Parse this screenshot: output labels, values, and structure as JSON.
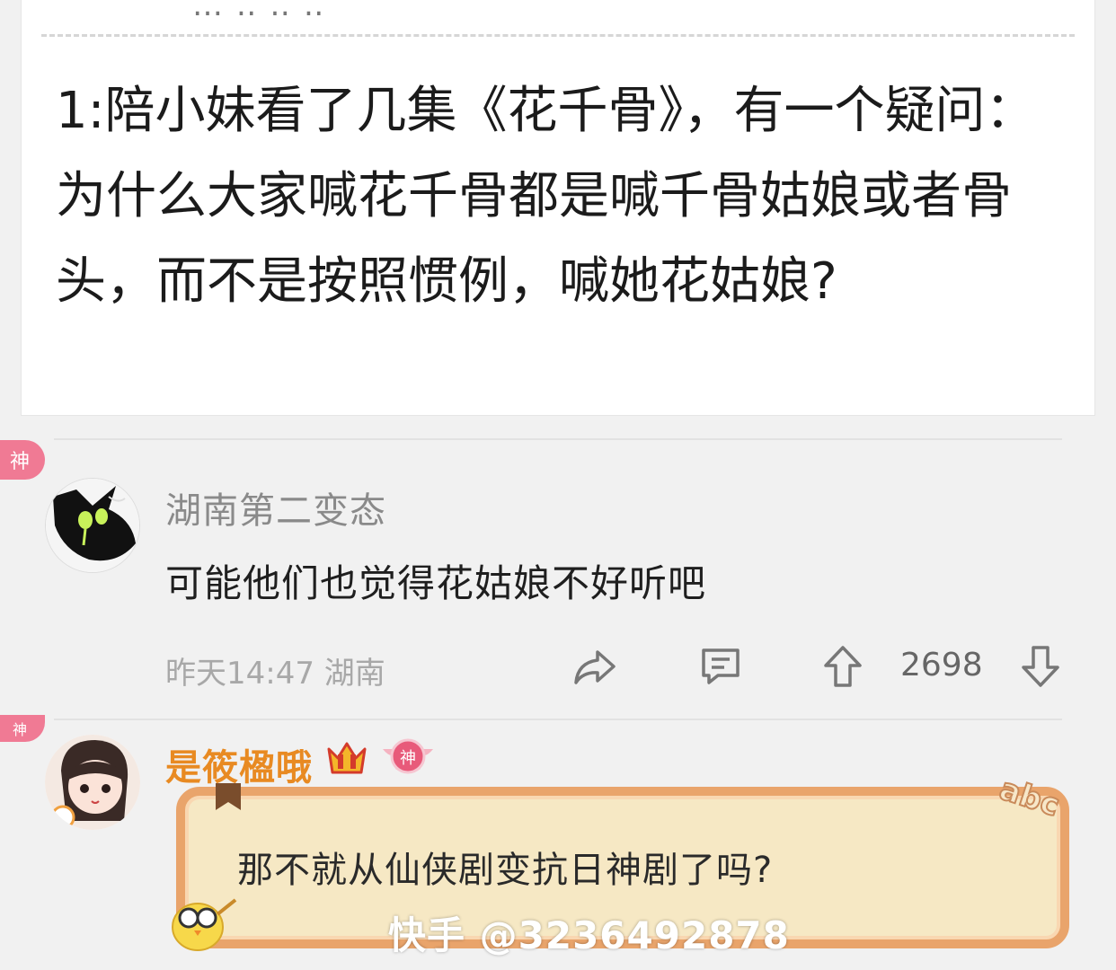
{
  "post": {
    "top_partial_text": "…  ‥ ‥ ‥",
    "text": "1:陪小妹看了几集《花千骨》，有一个疑问：为什么大家喊花千骨都是喊千骨姑娘或者骨头，而不是按照惯例，喊她花姑娘?"
  },
  "comments": [
    {
      "badge": "神",
      "username": "湖南第二变态",
      "text": "可能他们也觉得花姑娘不好听吧",
      "meta": "昨天14:47 湖南",
      "upvotes": "2698"
    },
    {
      "badge": "神",
      "username": "是筱楹哦",
      "badge_label": "神",
      "text": "那不就从仙侠剧变抗日神剧了吗?",
      "bubble_mark": "abc"
    }
  ],
  "watermark": "快手 @3236492878",
  "colors": {
    "accent_pink": "#f07a94",
    "vip_orange": "#e88a22",
    "bubble_border": "#e9a46b",
    "bubble_fill": "#f6e8c4"
  }
}
